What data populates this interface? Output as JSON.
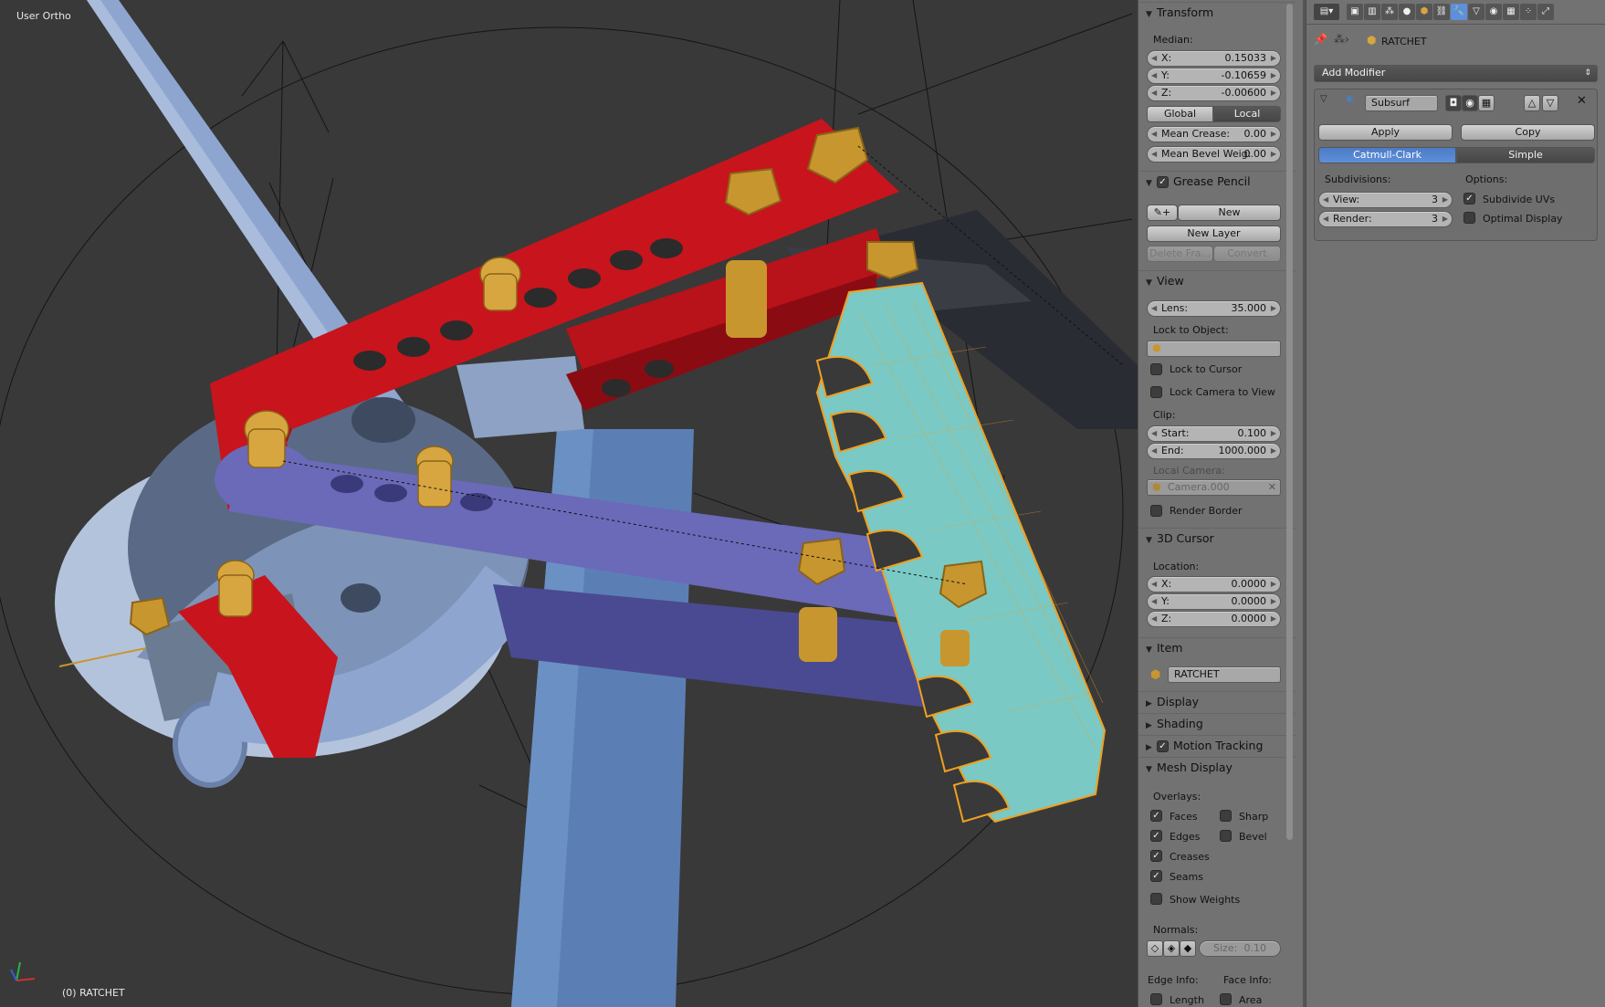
{
  "viewport": {
    "title": "User Ortho",
    "object_info": "(0) RATCHET"
  },
  "npanel": {
    "transform": {
      "header": "Transform",
      "median_label": "Median:",
      "x": {
        "label": "X:",
        "value": "0.15033"
      },
      "y": {
        "label": "Y:",
        "value": "-0.10659"
      },
      "z": {
        "label": "Z:",
        "value": "-0.00600"
      },
      "global_label": "Global",
      "local_label": "Local",
      "mean_crease": {
        "label": "Mean Crease:",
        "value": "0.00"
      },
      "mean_bevel": {
        "label": "Mean Bevel Weig:",
        "value": "0.00"
      }
    },
    "grease_pencil": {
      "header": "Grease Pencil",
      "enabled": true,
      "new_label": "New",
      "new_layer_label": "New Layer",
      "delete_frame_label": "Delete Fra...",
      "convert_label": "Convert"
    },
    "view": {
      "header": "View",
      "lens": {
        "label": "Lens:",
        "value": "35.000"
      },
      "lock_to_object_label": "Lock to Object:",
      "lock_to_cursor_label": "Lock to Cursor",
      "lock_to_cursor": false,
      "lock_camera_label": "Lock Camera to View",
      "lock_camera": false,
      "clip_label": "Clip:",
      "start": {
        "label": "Start:",
        "value": "0.100"
      },
      "end": {
        "label": "End:",
        "value": "1000.000"
      },
      "local_camera_label": "Local Camera:",
      "local_camera_value": "Camera.000",
      "render_border_label": "Render Border",
      "render_border": false
    },
    "cursor": {
      "header": "3D Cursor",
      "location_label": "Location:",
      "x": {
        "label": "X:",
        "value": "0.0000"
      },
      "y": {
        "label": "Y:",
        "value": "0.0000"
      },
      "z": {
        "label": "Z:",
        "value": "0.0000"
      }
    },
    "item": {
      "header": "Item",
      "name": "RATCHET"
    },
    "display": {
      "header": "Display"
    },
    "shading": {
      "header": "Shading"
    },
    "motion_tracking": {
      "header": "Motion Tracking",
      "enabled": true
    },
    "mesh_display": {
      "header": "Mesh Display",
      "overlays_label": "Overlays:",
      "faces": {
        "label": "Faces",
        "checked": true
      },
      "sharp": {
        "label": "Sharp",
        "checked": false
      },
      "edges": {
        "label": "Edges",
        "checked": true
      },
      "bevel": {
        "label": "Bevel",
        "checked": false
      },
      "creases": {
        "label": "Creases",
        "checked": true
      },
      "seams": {
        "label": "Seams",
        "checked": true
      },
      "show_weights": {
        "label": "Show Weights",
        "checked": false
      },
      "normals_label": "Normals:",
      "size": {
        "label": "Size:",
        "value": "0.10"
      },
      "edge_info_label": "Edge Info:",
      "face_info_label": "Face Info:",
      "length": {
        "label": "Length",
        "checked": false
      },
      "area": {
        "label": "Area",
        "checked": false
      }
    }
  },
  "properties": {
    "breadcrumb_object": "RATCHET",
    "add_modifier_label": "Add Modifier",
    "modifier": {
      "name": "Subsurf",
      "apply_label": "Apply",
      "copy_label": "Copy",
      "catmull_clark_label": "Catmull-Clark",
      "simple_label": "Simple",
      "subdivisions_label": "Subdivisions:",
      "options_label": "Options:",
      "view": {
        "label": "View:",
        "value": "3"
      },
      "render": {
        "label": "Render:",
        "value": "3"
      },
      "subdivide_uvs": {
        "label": "Subdivide UVs",
        "checked": true
      },
      "optimal_display": {
        "label": "Optimal Display",
        "checked": false
      }
    }
  },
  "colors": {
    "viewport_bg": "#393939",
    "panel_bg": "#727272",
    "red_arm": "#c8141c",
    "blue_arm": "#6a6ab8",
    "brass": "#c8962e",
    "ratchet_face": "#7ac9c4",
    "selection_orange": "#f0a020",
    "tube": "#8ea6cf"
  }
}
